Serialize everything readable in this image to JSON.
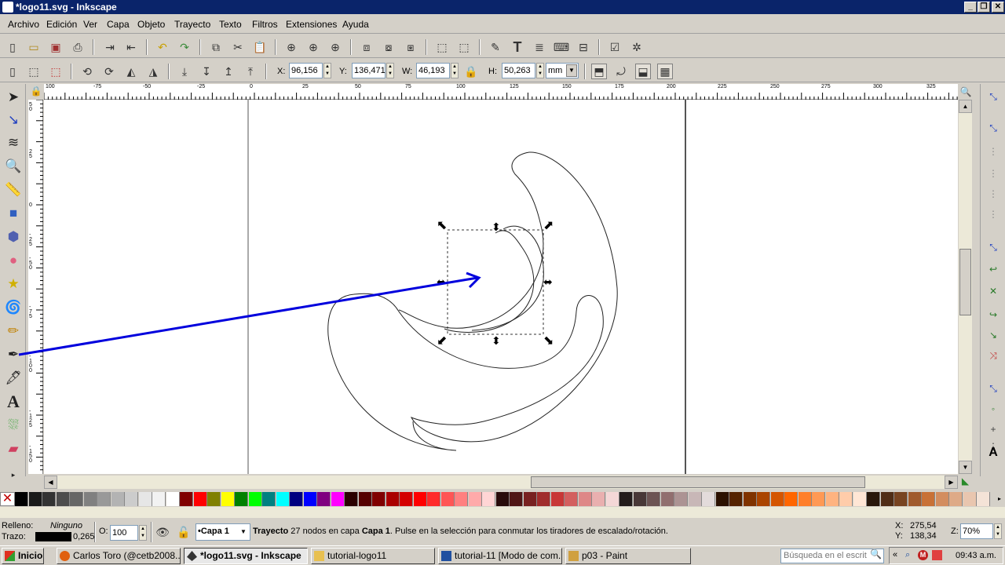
{
  "window": {
    "title": "*logo11.svg - Inkscape",
    "minimize": "_",
    "restore": "❐",
    "close": "✕"
  },
  "menu": [
    "Archivo",
    "Edición",
    "Ver",
    "Capa",
    "Objeto",
    "Trayecto",
    "Texto",
    "Filtros",
    "Extensiones",
    "Ayuda"
  ],
  "toolbar": {
    "x_label": "X:",
    "x_value": "96,156",
    "y_label": "Y:",
    "y_value": "136,471",
    "w_label": "W:",
    "w_value": "46,193",
    "h_label": "H:",
    "h_value": "50,263",
    "unit": "mm"
  },
  "ruler": {
    "h_ticks": [
      "100",
      "-75",
      "-50",
      "-25",
      "0",
      "25",
      "50",
      "75",
      "100",
      "125",
      "150",
      "175",
      "200",
      "225",
      "250",
      "275",
      "300",
      "325"
    ],
    "v_ticks": [
      "50",
      "25",
      "0",
      "-25",
      "-50",
      "-75",
      "-100",
      "-125",
      "-150",
      "-175"
    ]
  },
  "palette": {
    "colors": [
      "#000000",
      "#1a1a1a",
      "#333333",
      "#4d4d4d",
      "#666666",
      "#808080",
      "#999999",
      "#b3b3b3",
      "#cccccc",
      "#e6e6e6",
      "#f2f2f2",
      "#ffffff",
      "#800000",
      "#ff0000",
      "#808000",
      "#ffff00",
      "#008000",
      "#00ff00",
      "#008080",
      "#00ffff",
      "#000080",
      "#0000ff",
      "#800080",
      "#ff00ff",
      "#2b0000",
      "#550000",
      "#800000",
      "#aa0000",
      "#d40000",
      "#ff0000",
      "#ff2a2a",
      "#ff5555",
      "#ff8080",
      "#ffaaaa",
      "#ffd5d5",
      "#280b0b",
      "#501616",
      "#782121",
      "#a02c2c",
      "#c83737",
      "#d35f5f",
      "#de8787",
      "#e9afaf",
      "#f4d7d7",
      "#241c1c",
      "#483737",
      "#6c5353",
      "#916f6f",
      "#ac9393",
      "#c8b7b7",
      "#e3dbdb",
      "#2b1100",
      "#552200",
      "#803300",
      "#aa4400",
      "#d45500",
      "#ff6600",
      "#ff7f2a",
      "#ff9955",
      "#ffb380",
      "#ffccaa",
      "#ffe6d5",
      "#28170b",
      "#502d16",
      "#784421",
      "#a05a2c",
      "#c87137",
      "#d38d5f",
      "#deaa87",
      "#e9c6af",
      "#f4e3d7"
    ]
  },
  "status": {
    "fill_label": "Relleno:",
    "fill_value": "Ninguno",
    "stroke_label": "Trazo:",
    "stroke_width": "0,265",
    "opacity_label": "O:",
    "opacity_value": "100",
    "layer": "•Capa 1",
    "message_bold": "Trayecto",
    "message_mid": " 27 nodos en capa ",
    "message_layer": "Capa 1",
    "message_rest": ". Pulse en la selección para conmutar los tiradores de escalado/rotación.",
    "cursor_x_label": "X:",
    "cursor_x": "275,54",
    "cursor_y_label": "Y:",
    "cursor_y": "138,34",
    "zoom_label": "Z:",
    "zoom": "70%"
  },
  "taskbar": {
    "start": "Inicio",
    "tasks": [
      "Carlos Toro (@cetb2008...",
      "*logo11.svg - Inkscape",
      "tutorial-logo11",
      "tutorial-11 [Modo de com...",
      "p03 - Paint"
    ],
    "search_placeholder": "Búsqueda en el escrit",
    "clock": "09:43 a.m."
  },
  "colors": {
    "accent": "#0a246a",
    "arrow": "#0000dd"
  }
}
